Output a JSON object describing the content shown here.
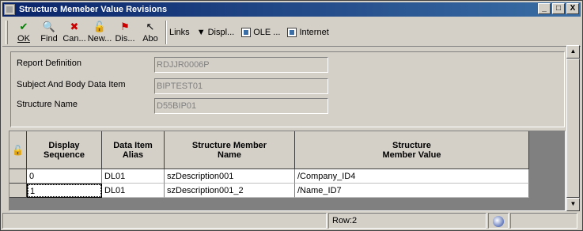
{
  "window": {
    "title": "Structure Memeber Value Revisions",
    "controls": [
      "_",
      "□",
      "X"
    ]
  },
  "toolbar": {
    "buttons": [
      {
        "label": "OK",
        "icon": "checkmark-icon",
        "glyph": "✔",
        "color": "#008000"
      },
      {
        "label": "Find",
        "icon": "find-icon",
        "glyph": "🔍",
        "color": "#000000"
      },
      {
        "label": "Can...",
        "icon": "cancel-icon",
        "glyph": "✖",
        "color": "#cc0000"
      },
      {
        "label": "New...",
        "icon": "new-icon",
        "glyph": "🔓",
        "color": "#000000"
      },
      {
        "label": "Dis...",
        "icon": "display-icon",
        "glyph": "⚑",
        "color": "#cc0000"
      },
      {
        "label": "Abo",
        "icon": "about-icon",
        "glyph": "↖",
        "color": "#000000"
      }
    ],
    "links": "Links",
    "display": "Displ...",
    "ole": "OLE ...",
    "internet": "Internet"
  },
  "form": {
    "report_definition": {
      "label": "Report Definition",
      "value": "RDJJR0006P"
    },
    "subject_body": {
      "label": "Subject And Body Data Item",
      "value": "BIPTEST01"
    },
    "structure_name": {
      "label": "Structure Name",
      "value": "D55BIP01"
    }
  },
  "grid": {
    "columns": [
      "Display\nSequence",
      "Data Item\nAlias",
      "Structure Member\nName",
      "Structure\nMember Value"
    ],
    "rows": [
      [
        "0",
        "DL01",
        "szDescription001",
        "/Company_ID4"
      ],
      [
        "1",
        "DL01",
        "szDescription001_2",
        "/Name_ID7"
      ]
    ]
  },
  "status": {
    "row": "Row:2"
  }
}
